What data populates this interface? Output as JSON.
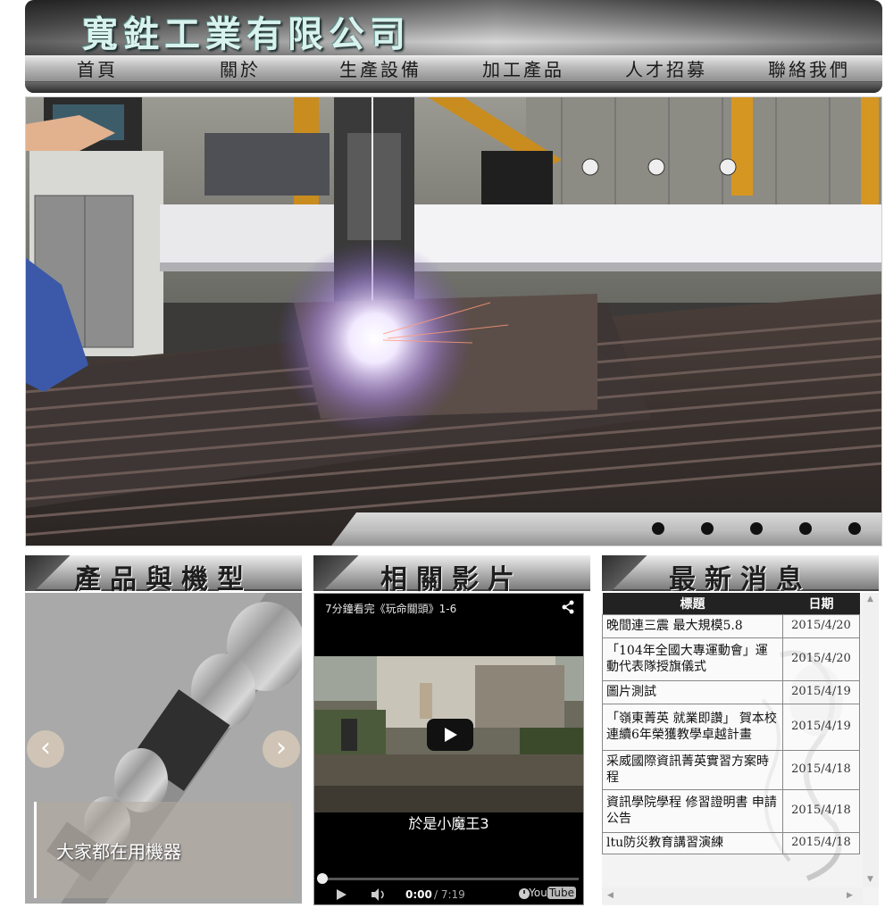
{
  "header": {
    "company_name": "寬鉎工業有限公司"
  },
  "nav": {
    "items": [
      {
        "label": "首頁"
      },
      {
        "label": "關於"
      },
      {
        "label": "生產設備"
      },
      {
        "label": "加工產品"
      },
      {
        "label": "人才招募"
      },
      {
        "label": "聯絡我們"
      }
    ]
  },
  "hero": {
    "slide_count": 5
  },
  "sections": {
    "products_title": "產品與機型",
    "videos_title": "相關影片",
    "news_title": "最新消息"
  },
  "products": {
    "caption": "大家都在用機器",
    "prev_icon": "chevron-left-icon",
    "next_icon": "chevron-right-icon"
  },
  "video": {
    "title": "7分鐘看完《玩命關頭》1-6",
    "subtitle": "於是小魔王3",
    "time_current": "0:00",
    "time_total": "/ 7:19",
    "logo_you": "You",
    "logo_tube": "Tube"
  },
  "news": {
    "col_title": "標題",
    "col_date": "日期",
    "rows": [
      {
        "title": "晚間連三震 最大規模5.8",
        "date": "2015/4/20"
      },
      {
        "title": "「104年全國大專運動會」運動代表隊授旗儀式",
        "date": "2015/4/20"
      },
      {
        "title": "圖片測試",
        "date": "2015/4/19"
      },
      {
        "title": "「嶺東菁英 就業即讚」 賀本校連續6年榮獲教學卓越計畫",
        "date": "2015/4/19"
      },
      {
        "title": "采威國際資訊菁英實習方案時程",
        "date": "2015/4/18"
      },
      {
        "title": "資訊學院學程 修習證明書 申請公告",
        "date": "2015/4/18"
      },
      {
        "title": "ltu防災教育講習演練",
        "date": "2015/4/18"
      }
    ]
  },
  "colors": {
    "title_text": "#d8f2ee",
    "nav_text": "#1a1a1a",
    "news_header_bg": "#222222"
  }
}
